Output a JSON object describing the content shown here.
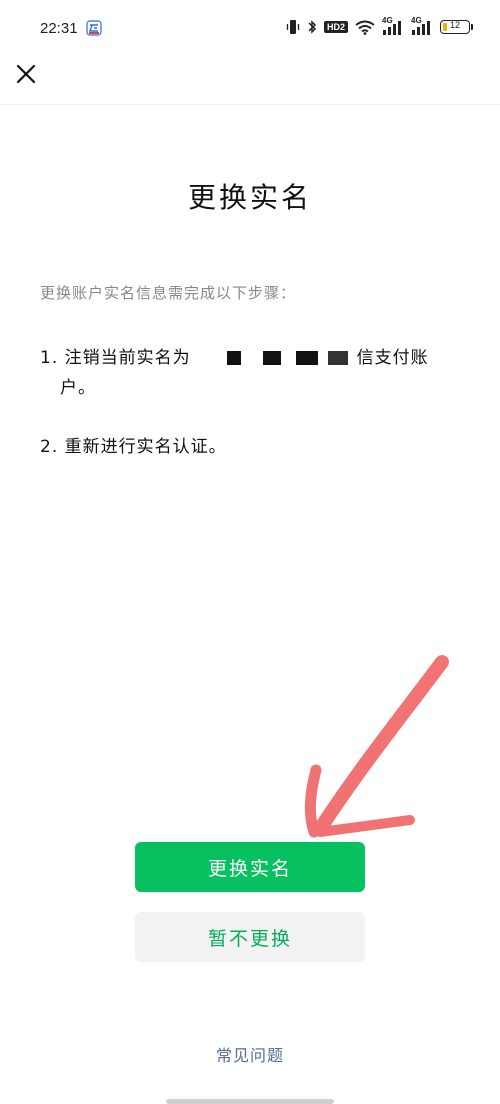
{
  "status_bar": {
    "time": "22:31",
    "network_badge": "HD2",
    "signal_label_1": "4G",
    "signal_label_2": "4G",
    "battery_level": "12"
  },
  "nav": {
    "close_icon": "close-icon"
  },
  "page": {
    "title": "更换实名",
    "intro": "更换账户实名信息需完成以下步骤：",
    "step1_prefix": "1. 注销当前实名为",
    "step1_suffix": "信支付账",
    "step1_cont": "户。",
    "step2": "2. 重新进行实名认证。"
  },
  "buttons": {
    "primary": "更换实名",
    "secondary": "暂不更换"
  },
  "footer": {
    "faq": "常见问题"
  },
  "colors": {
    "primary_green": "#07c160",
    "secondary_text_green": "#06ad56",
    "link_blue": "#576b95",
    "annotation_red": "#ee5a5a"
  }
}
